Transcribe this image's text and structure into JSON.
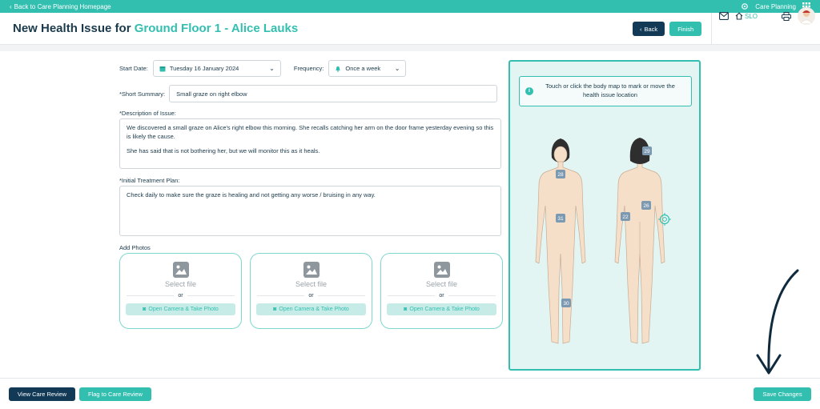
{
  "topbar": {
    "back_label": "Back to Care Planning Homepage",
    "app_label": "Care Planning"
  },
  "header": {
    "title_prefix": "New Health Issue for ",
    "title_subject": "Ground Floor 1 - Alice Lauks",
    "back_label": "Back",
    "finish_label": "Finish",
    "slo_label": "SLO"
  },
  "form": {
    "start_date_label": "Start Date:",
    "start_date_value": "Tuesday 16 January 2024",
    "frequency_label": "Frequency:",
    "frequency_value": "Once a week",
    "short_summary_label": "*Short Summary:",
    "short_summary_value": "Small graze on right elbow",
    "description_label": "*Description of Issue:",
    "description_p1": "We discovered a small graze on Alice's right elbow this morning. She recalls catching her arm on the door frame yesterday evening so this is likely the cause.",
    "description_p2": "She has said that is not bothering her, but we will monitor this as it heals.",
    "treatment_label": "*Initial Treatment Plan:",
    "treatment_value": "Check daily to make sure the graze is healing and not getting any worse / bruising in any way.",
    "add_photos_label": "Add Photos",
    "photo_slots": [
      {
        "select": "Select file",
        "or": "or",
        "camera": "Open Camera & Take Photo"
      },
      {
        "select": "Select file",
        "or": "or",
        "camera": "Open Camera & Take Photo"
      },
      {
        "select": "Select file",
        "or": "or",
        "camera": "Open Camera & Take Photo"
      }
    ]
  },
  "bodymap": {
    "info_text": "Touch or click the body map to mark or move the health issue location",
    "front_markers": [
      "28",
      "31",
      "30"
    ],
    "back_markers": [
      "29",
      "26",
      "22"
    ]
  },
  "footer": {
    "view_care_review": "View Care Review",
    "flag_care_review": "Flag to Care Review",
    "save_changes": "Save Changes"
  },
  "colors": {
    "teal": "#33bfb0",
    "navy": "#123a57",
    "marker": "#7c99b2",
    "skin": "#f6dfc8"
  }
}
